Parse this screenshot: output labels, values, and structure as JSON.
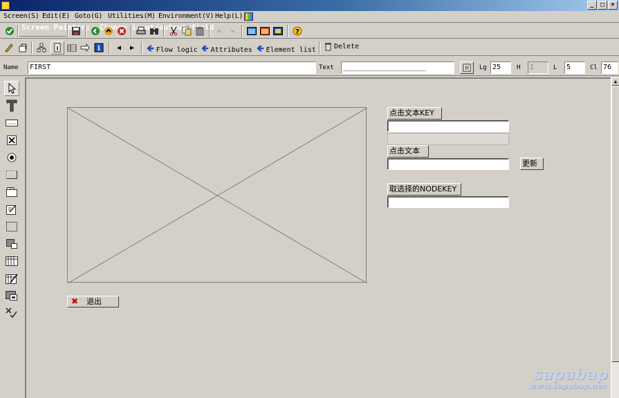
{
  "window": {
    "title": "Screen Painter:  Change input/output field",
    "buttons": [
      "_",
      "□",
      "×"
    ]
  },
  "menu": [
    {
      "label": "Screen(S)"
    },
    {
      "label": "Edit(E)"
    },
    {
      "label": "Goto(G)"
    },
    {
      "label": "Utilities(M)"
    },
    {
      "label": "Environment(V)"
    },
    {
      "label": "Help(L)"
    }
  ],
  "toolbar2": {
    "flow_logic": "Flow logic",
    "attributes": "Attributes",
    "element_list": "Element list",
    "delete": "Delete"
  },
  "attributes": {
    "name_label": "Name",
    "name_value": "FIRST",
    "text_label": "Text",
    "text_value": "____________________",
    "lg_label": "Lg",
    "lg_value": "25",
    "h_label": "H",
    "h_value": "1",
    "l_label": "L",
    "l_value": "5",
    "cl_label": "Cl",
    "cl_value": "76"
  },
  "screen": {
    "label_node_key": "点击文本KEY",
    "label_node_text": "点击文本",
    "refresh_button": "更新",
    "label_selected_key": "取选择的NODEKEY",
    "exit_button": "退出"
  },
  "watermark": {
    "brand": "sapabap",
    "url": "www.sapabap.net"
  },
  "colors": {
    "title_start": "#0a246a",
    "title_end": "#a6caf0",
    "window_bg": "#d4d0c8"
  }
}
